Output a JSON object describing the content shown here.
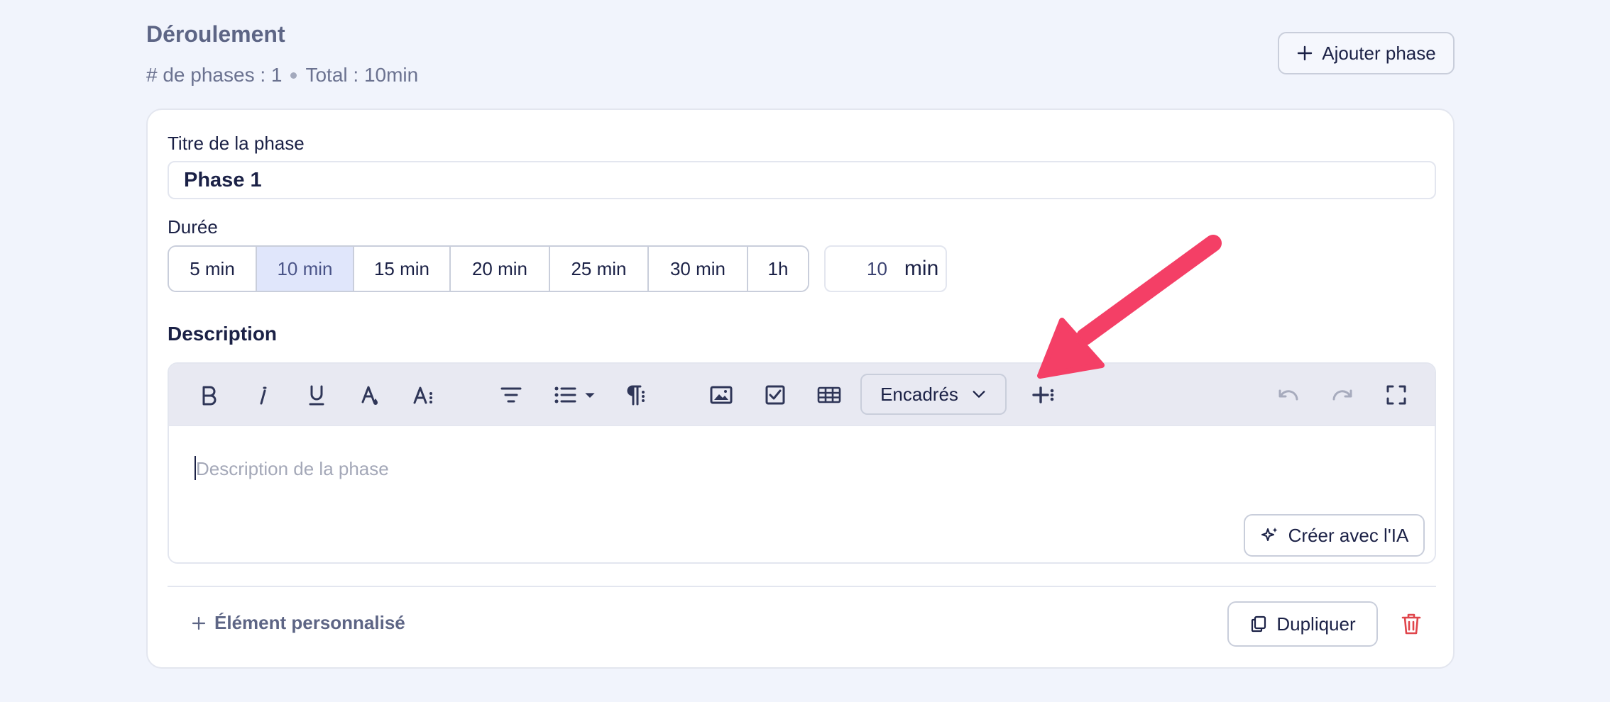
{
  "section": {
    "title": "Déroulement",
    "phase_count": "# de phases : 1",
    "total": "Total : 10min",
    "add_phase_label": "Ajouter phase"
  },
  "phase": {
    "title_label": "Titre de la phase",
    "title_value": "Phase 1",
    "duration_label": "Durée",
    "duration_options": [
      "5 min",
      "10 min",
      "15 min",
      "20 min",
      "25 min",
      "30 min",
      "1h"
    ],
    "duration_selected": "10 min",
    "duration_value": "10",
    "duration_unit": "min"
  },
  "description": {
    "label": "Description",
    "placeholder": "Description de la phase",
    "encadres_label": "Encadrés",
    "ia_label": "Créer avec l'IA"
  },
  "footer": {
    "custom_element_label": "Élément personnalisé",
    "duplicate_label": "Dupliquer"
  },
  "colors": {
    "background": "#f1f4fc",
    "accent_selected": "#e0e6fb",
    "annotation_arrow": "#f43f66",
    "delete": "#e0454b"
  },
  "toolbar_icons": [
    "bold-icon",
    "italic-icon",
    "underline-icon",
    "text-color-icon",
    "font-size-icon",
    "align-icon",
    "bullet-list-icon",
    "list-dropdown-icon",
    "paragraph-icon",
    "image-icon",
    "checkbox-icon",
    "table-icon",
    "insert-more-icon",
    "undo-icon",
    "redo-icon",
    "fullscreen-icon"
  ]
}
